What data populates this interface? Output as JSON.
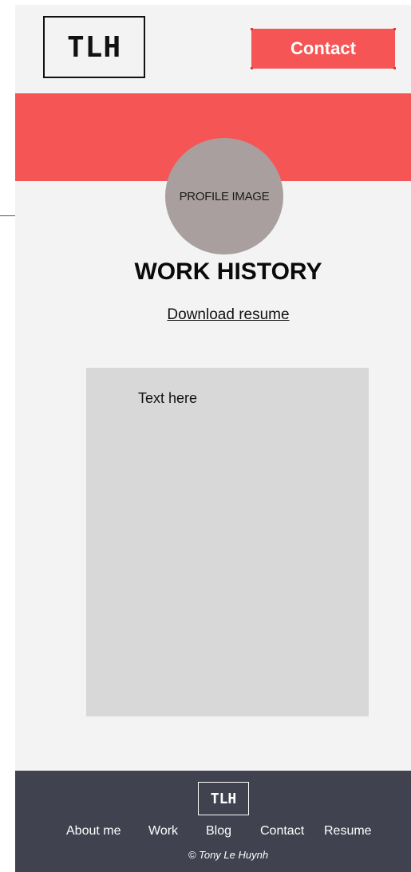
{
  "header": {
    "logo_text": "TLH",
    "contact_label": "Contact"
  },
  "profile": {
    "placeholder": "PROFILE IMAGE"
  },
  "main": {
    "title": "WORK HISTORY",
    "download_link": "Download resume",
    "content_text": "Text here"
  },
  "footer": {
    "logo_text": "TLH",
    "nav": [
      {
        "label": "About me"
      },
      {
        "label": "Work"
      },
      {
        "label": "Blog"
      },
      {
        "label": "Contact"
      },
      {
        "label": "Resume"
      }
    ],
    "copyright": "© Tony Le Huynh"
  },
  "colors": {
    "accent": "#f55655",
    "page_bg": "#f3f3f3",
    "footer_bg": "#40434f",
    "profile_bg": "#aa9f9f",
    "content_box_bg": "#d8d8d8"
  }
}
